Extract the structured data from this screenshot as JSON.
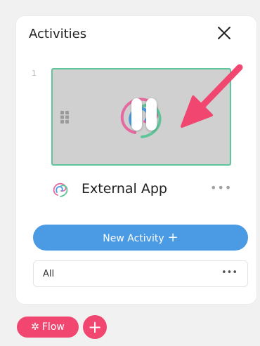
{
  "panel": {
    "title": "Activities",
    "close_icon": "close-icon"
  },
  "activities": [
    {
      "index": "1",
      "app_name": "External App",
      "state": "paused",
      "more_label": "•••"
    }
  ],
  "new_activity": {
    "label": "New Activity",
    "plus": "+"
  },
  "filter": {
    "value": "All",
    "more_label": "•••"
  },
  "bottom_bar": {
    "flow_label": "Flow",
    "flow_icon": "sparkle-icon",
    "add_label": "+"
  },
  "colors": {
    "card_border": "#5fc59a",
    "primary_button": "#4a9be4",
    "flow_button": "#f0466f",
    "annotation_arrow": "#f0466f"
  }
}
